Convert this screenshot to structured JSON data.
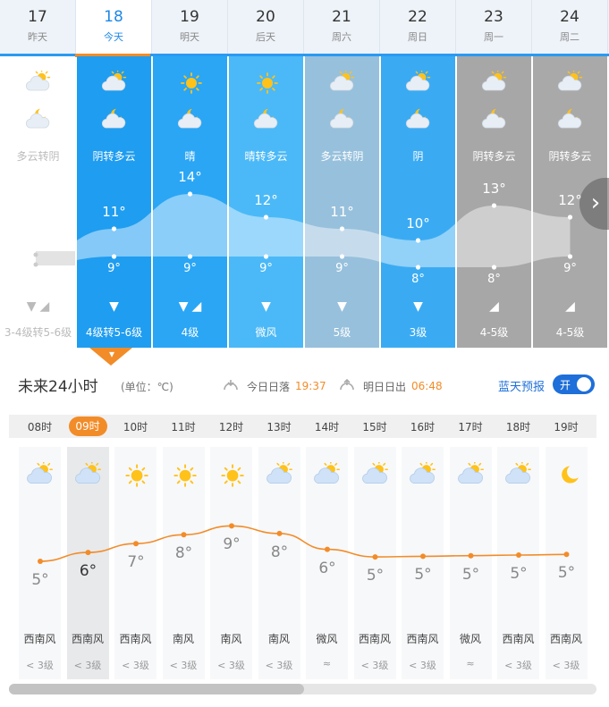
{
  "days": [
    {
      "date": "17",
      "label": "昨天",
      "condition": "多云转阴",
      "high": "",
      "low": "",
      "wind_level": "3-4级转5-6级",
      "icons": [
        "cloud-sun-icon",
        "cloud-moon-icon"
      ],
      "wind_arrows": [
        "arrow-down-icon",
        "arrow-northeast-icon"
      ],
      "bg": "#ffffff",
      "past": true
    },
    {
      "date": "18",
      "label": "今天",
      "condition": "阴转多云",
      "high": "11°",
      "low": "9°",
      "wind_level": "4级转5-6级",
      "icons": [
        "cloud-sun-icon",
        "cloud-moon-icon"
      ],
      "wind_arrows": [
        "arrow-down-icon"
      ],
      "bg": "#1f9df0",
      "past": false,
      "today": true
    },
    {
      "date": "19",
      "label": "明天",
      "condition": "晴",
      "high": "14°",
      "low": "9°",
      "wind_level": "4级",
      "icons": [
        "sun-icon",
        "cloud-moon-icon"
      ],
      "wind_arrows": [
        "arrow-down-icon",
        "arrow-northeast-icon"
      ],
      "bg": "#2aa6f5",
      "past": false
    },
    {
      "date": "20",
      "label": "后天",
      "condition": "晴转多云",
      "high": "12°",
      "low": "9°",
      "wind_level": "微风",
      "icons": [
        "sun-icon",
        "cloud-moon-icon"
      ],
      "wind_arrows": [
        "arrow-down-icon"
      ],
      "bg": "#4bb9f7",
      "past": false
    },
    {
      "date": "21",
      "label": "周六",
      "condition": "多云转阴",
      "high": "11°",
      "low": "9°",
      "wind_level": "5级",
      "icons": [
        "cloud-sun-icon",
        "cloud-moon-icon"
      ],
      "wind_arrows": [
        "arrow-down-icon"
      ],
      "bg": "#97c0dc",
      "past": false
    },
    {
      "date": "22",
      "label": "周日",
      "condition": "阴",
      "high": "10°",
      "low": "8°",
      "wind_level": "3级",
      "icons": [
        "cloud-sun-icon",
        "cloud-moon-icon"
      ],
      "wind_arrows": [
        "arrow-down-icon"
      ],
      "bg": "#3aabf3",
      "past": false
    },
    {
      "date": "23",
      "label": "周一",
      "condition": "阴转多云",
      "high": "13°",
      "low": "8°",
      "wind_level": "4-5级",
      "icons": [
        "cloud-sun-icon",
        "cloud-moon-icon"
      ],
      "wind_arrows": [
        "arrow-northeast-icon"
      ],
      "bg": "#a7a7a7",
      "past": false
    },
    {
      "date": "24",
      "label": "周二",
      "condition": "阴转多云",
      "high": "12°",
      "low": "9°",
      "wind_level": "4-5级",
      "icons": [
        "cloud-sun-icon",
        "cloud-moon-icon"
      ],
      "wind_arrows": [
        "arrow-northeast-icon"
      ],
      "bg": "#a9a9a9",
      "past": false
    }
  ],
  "hourly_section": {
    "title": "未来24小时",
    "unit": "(单位：℃)",
    "sunset_label": "今日日落",
    "sunset_time": "19:37",
    "sunrise_label": "明日日出",
    "sunrise_time": "06:48",
    "bluesky_label": "蓝天预报",
    "toggle_label": "开"
  },
  "hours": [
    {
      "time": "08时",
      "temp": "5°",
      "wind": "西南风",
      "level": "< 3级",
      "icon": "cloud-sun-icon"
    },
    {
      "time": "09时",
      "temp": "6°",
      "wind": "西南风",
      "level": "< 3级",
      "icon": "cloud-sun-icon",
      "now": true
    },
    {
      "time": "10时",
      "temp": "7°",
      "wind": "西南风",
      "level": "< 3级",
      "icon": "sun-icon"
    },
    {
      "time": "11时",
      "temp": "8°",
      "wind": "南风",
      "level": "< 3级",
      "icon": "sun-icon"
    },
    {
      "time": "12时",
      "temp": "9°",
      "wind": "南风",
      "level": "< 3级",
      "icon": "sun-icon"
    },
    {
      "time": "13时",
      "temp": "8°",
      "wind": "南风",
      "level": "< 3级",
      "icon": "cloud-sun-icon"
    },
    {
      "time": "14时",
      "temp": "6°",
      "wind": "微风",
      "level": "≈",
      "icon": "cloud-sun-icon"
    },
    {
      "time": "15时",
      "temp": "5°",
      "wind": "西南风",
      "level": "< 3级",
      "icon": "cloud-sun-icon"
    },
    {
      "time": "16时",
      "temp": "5°",
      "wind": "西南风",
      "level": "< 3级",
      "icon": "cloud-sun-icon"
    },
    {
      "time": "17时",
      "temp": "5°",
      "wind": "微风",
      "level": "≈",
      "icon": "cloud-sun-icon"
    },
    {
      "time": "18时",
      "temp": "5°",
      "wind": "西南风",
      "level": "< 3级",
      "icon": "cloud-sun-icon"
    },
    {
      "time": "19时",
      "temp": "5°",
      "wind": "西南风",
      "level": "< 3级",
      "icon": "moon-icon"
    }
  ],
  "colors": {
    "accent": "#f28c28",
    "brand": "#1e88e5",
    "toggle": "#1e6fd9"
  }
}
